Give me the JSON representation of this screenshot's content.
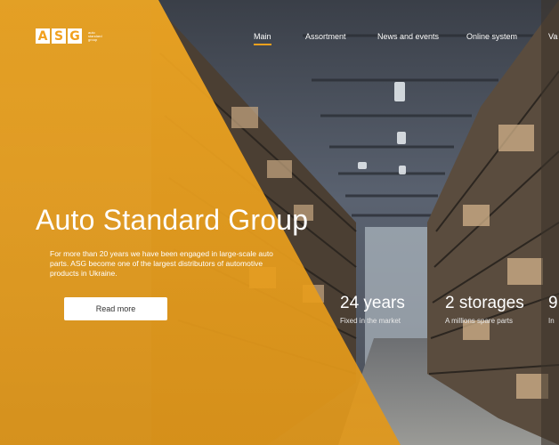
{
  "logo": {
    "letters": [
      "A",
      "S",
      "G"
    ],
    "tagline": "auto standard group"
  },
  "nav": {
    "items": [
      {
        "label": "Main",
        "active": true
      },
      {
        "label": "Assortment",
        "active": false
      },
      {
        "label": "News and events",
        "active": false
      },
      {
        "label": "Online system",
        "active": false
      },
      {
        "label": "Va",
        "active": false
      }
    ]
  },
  "hero": {
    "title": "Auto Standard Group",
    "description": "For more than 20 years we have been engaged in large-scale auto parts. ASG become one of the largest distributors of automotive products in Ukraine.",
    "button_label": "Read more"
  },
  "stats": [
    {
      "value": "24 years",
      "label": "Fixed in the market"
    },
    {
      "value": "2 storages",
      "label": "A millions spare parts"
    },
    {
      "value": "9",
      "label": "In"
    }
  ],
  "colors": {
    "accent": "#f2a11e",
    "text": "#ffffff"
  }
}
